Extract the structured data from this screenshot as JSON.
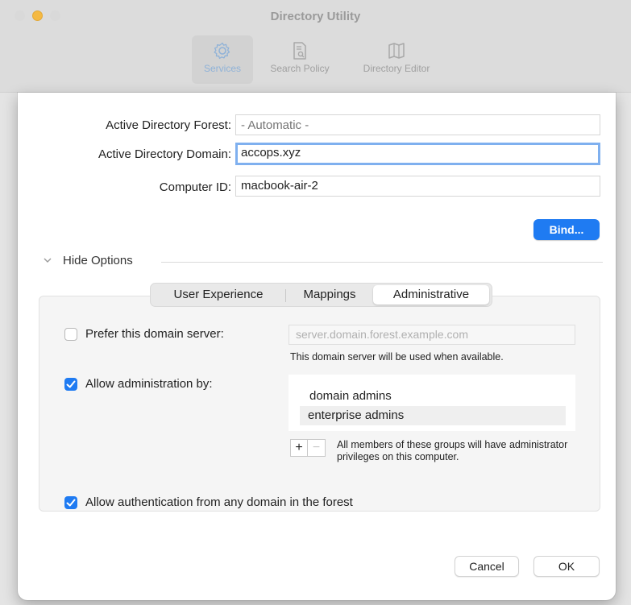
{
  "window": {
    "title": "Directory Utility",
    "toolbar": [
      {
        "label": "Services",
        "icon": "gear-icon",
        "active": true
      },
      {
        "label": "Search Policy",
        "icon": "document-search-icon",
        "active": false
      },
      {
        "label": "Directory Editor",
        "icon": "map-icon",
        "active": false
      }
    ]
  },
  "form": {
    "forest_label": "Active Directory Forest:",
    "forest_placeholder": "- Automatic -",
    "domain_label": "Active Directory Domain:",
    "domain_value": "accops.xyz",
    "computer_label": "Computer ID:",
    "computer_value": "macbook-air-2",
    "bind_label": "Bind..."
  },
  "options": {
    "toggle_label": "Hide Options",
    "tabs": [
      "User Experience",
      "Mappings",
      "Administrative"
    ],
    "selected_tab": "Administrative"
  },
  "administrative": {
    "prefer_label": "Prefer this domain server:",
    "prefer_checked": false,
    "server_placeholder": "server.domain.forest.example.com",
    "server_hint": "This domain server will be used when available.",
    "allow_admin_label": "Allow administration by:",
    "allow_admin_checked": true,
    "admin_groups": [
      "domain admins",
      "enterprise admins"
    ],
    "selected_group": "enterprise admins",
    "plus_label": "+",
    "minus_label": "−",
    "groups_hint": "All members of these groups will have administrator privileges on this computer.",
    "allow_auth_label": "Allow authentication from any domain in the forest",
    "allow_auth_checked": true
  },
  "buttons": {
    "cancel": "Cancel",
    "ok": "OK"
  },
  "colors": {
    "accent": "#1f7bf2",
    "focus_ring": "#7fb0ef"
  }
}
